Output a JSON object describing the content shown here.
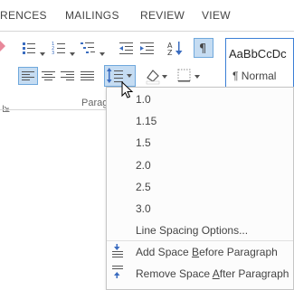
{
  "tabs": [
    "RENCES",
    "MAILINGS",
    "REVIEW",
    "VIEW"
  ],
  "styles": {
    "sample": "AaBbCcDc",
    "name": "¶ Normal"
  },
  "group_label": "Parag",
  "menu": {
    "values": [
      "1.0",
      "1.15",
      "1.5",
      "2.0",
      "2.5",
      "3.0"
    ],
    "options_label": "Line Spacing Options...",
    "add_before": {
      "pre": "Add Space ",
      "key": "B",
      "post": "efore Paragraph"
    },
    "remove_after": {
      "pre": "Remove Space ",
      "key": "A",
      "post": "fter Paragraph"
    }
  },
  "colors": {
    "accent": "#2b579a",
    "selected_bg": "#c5dcf2",
    "selected_border": "#6fa8dc"
  }
}
